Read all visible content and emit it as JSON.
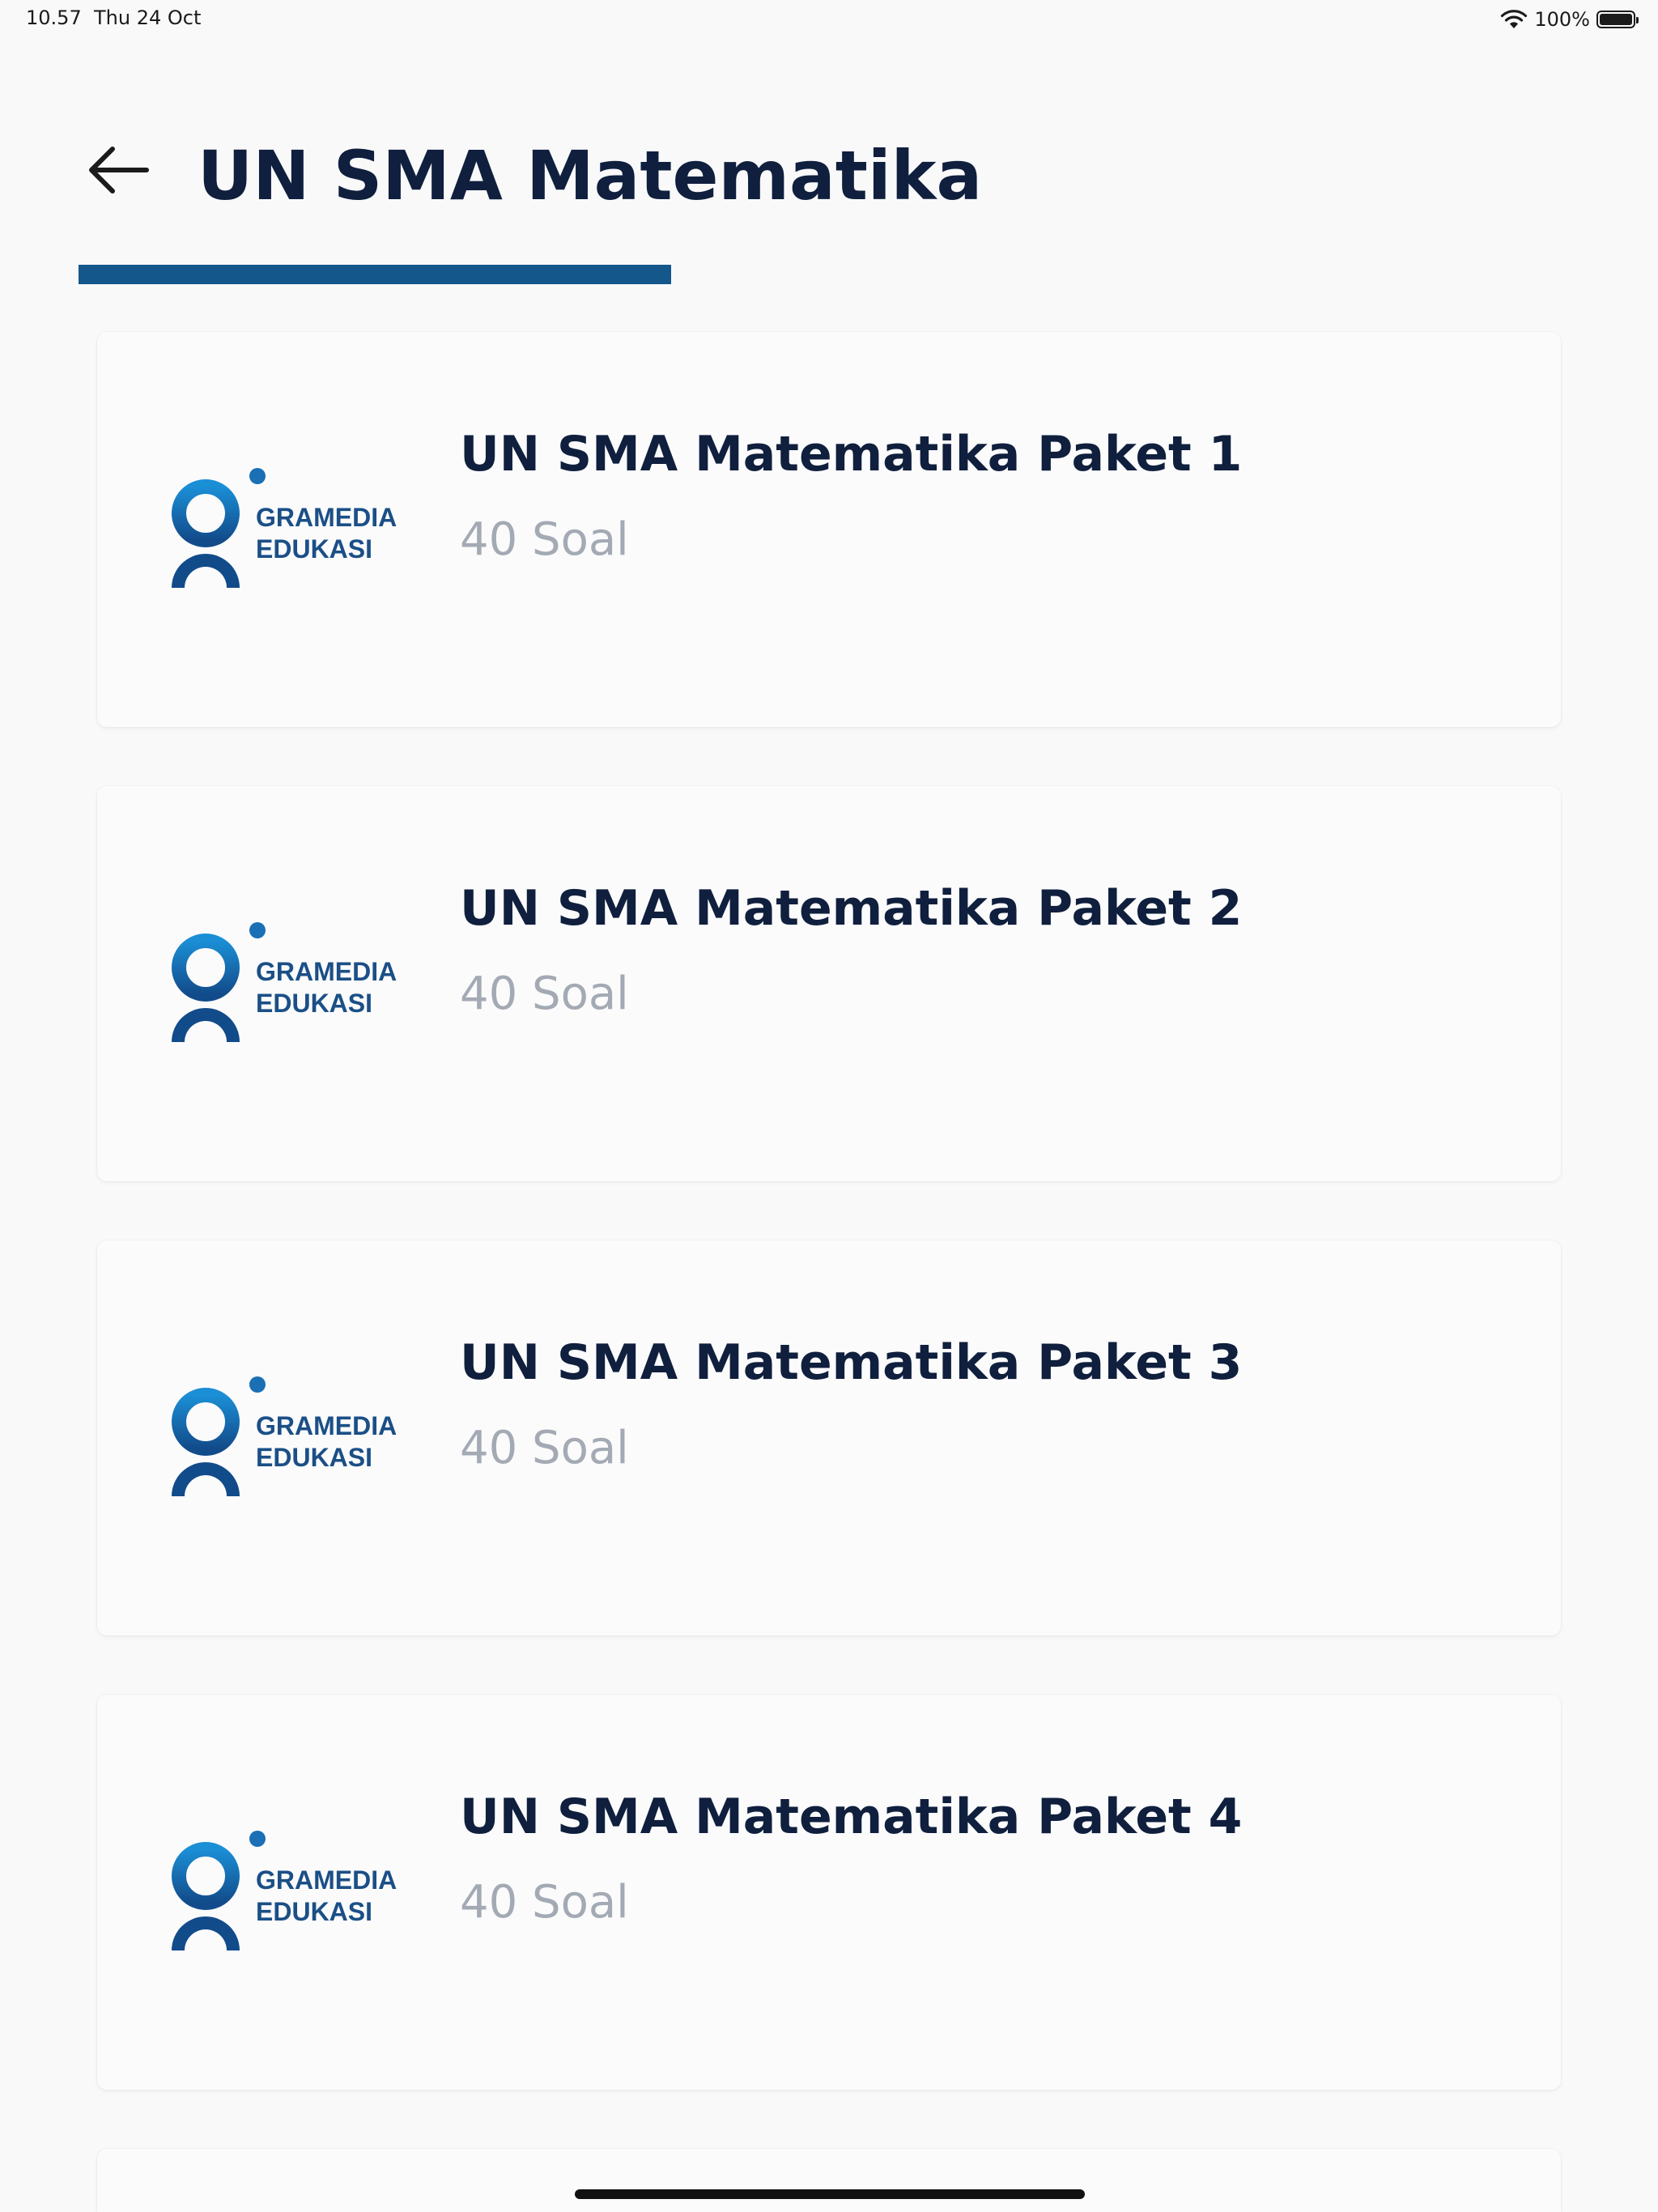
{
  "status_bar": {
    "time": "10.57",
    "date": "Thu 24 Oct",
    "battery_percent": "100%",
    "battery_level": 1.0
  },
  "header": {
    "title": "UN SMA Matematika",
    "back_icon": "arrow-left-icon"
  },
  "colors": {
    "accent": "#14578a",
    "title": "#0f1f3d",
    "subtitle": "#a4aab4",
    "logo_blue_light": "#1b8fd6",
    "logo_blue_dark": "#124b8a"
  },
  "brand": {
    "line1": "GRAMEDIA",
    "line2": "EDUKASI"
  },
  "packages": [
    {
      "title": "UN SMA Matematika Paket 1",
      "subtitle": "40 Soal"
    },
    {
      "title": "UN SMA Matematika Paket 2",
      "subtitle": "40 Soal"
    },
    {
      "title": "UN SMA Matematika Paket 3",
      "subtitle": "40 Soal"
    },
    {
      "title": "UN SMA Matematika Paket 4",
      "subtitle": "40 Soal"
    }
  ]
}
